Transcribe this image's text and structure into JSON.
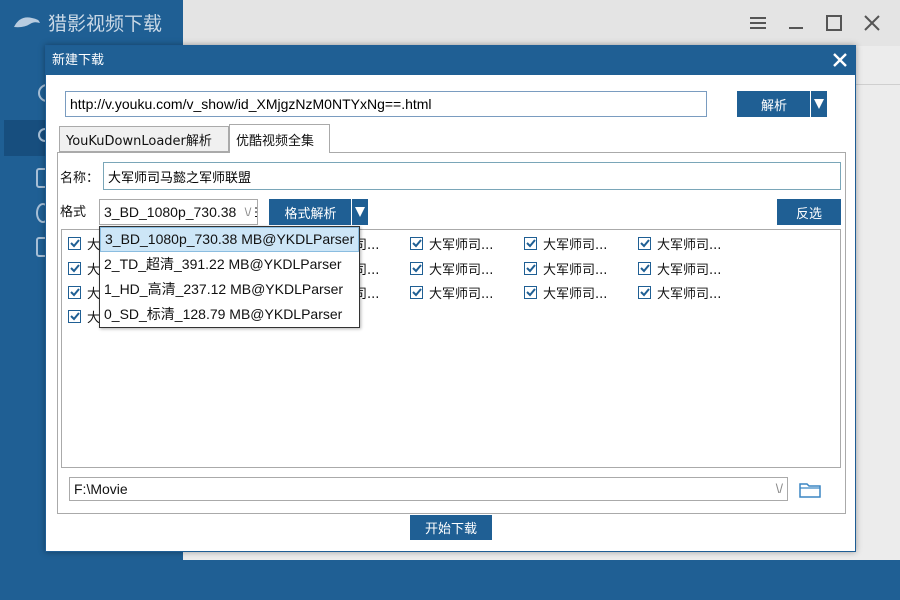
{
  "app": {
    "title": "猎影视频下载"
  },
  "colors": {
    "accent": "#1f5f94"
  },
  "dialog": {
    "title": "新建下载",
    "url_value": "http://v.youku.com/v_show/id_XMjgzNzM0NTYxNg==.html",
    "parse_label": "解析",
    "tabs": [
      {
        "label": "YouKuDownLoader解析"
      },
      {
        "label": "优酷视频全集"
      }
    ],
    "name_label": "名称：",
    "name_value": "大军师司马懿之军师联盟",
    "format_label": "格式",
    "format_selected": "3_BD_1080p_730.38 MB@YKDLParser",
    "format_parse_label": "格式解析",
    "invert_label": "反选",
    "format_options": [
      "3_BD_1080p_730.38 MB@YKDLParser",
      "2_TD_超清_391.22 MB@YKDLParser",
      "1_HD_高清_237.12 MB@YKDLParser",
      "0_SD_标清_128.79 MB@YKDLParser"
    ],
    "episode_first_col_char": "大",
    "episode_label": "大军师司...",
    "episode_partial_label": "司...",
    "save_path": "F:\\Movie",
    "start_label": "开始下载"
  }
}
